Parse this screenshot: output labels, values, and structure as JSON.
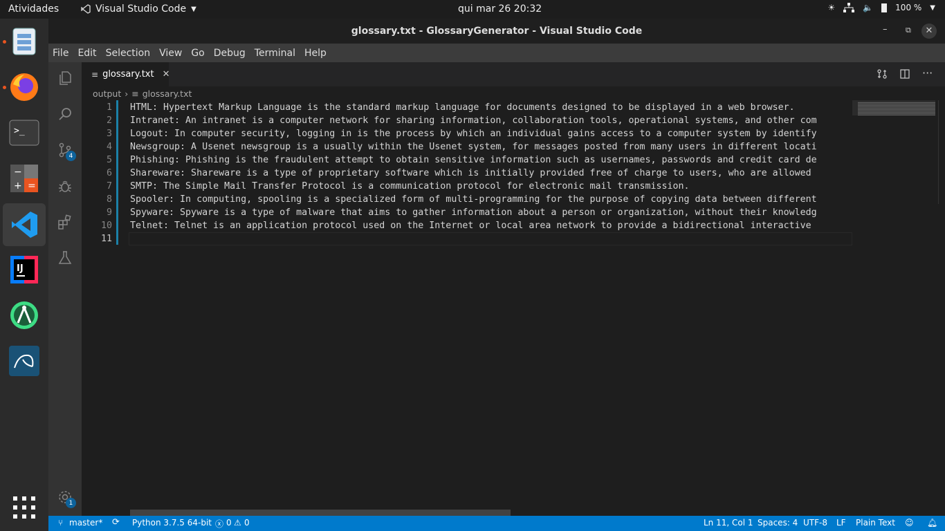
{
  "system": {
    "activities": "Atividades",
    "app_name": "Visual Studio Code",
    "clock": "qui mar 26  20:32",
    "battery": "100 %"
  },
  "window": {
    "title": "glossary.txt - GlossaryGenerator - Visual Studio Code"
  },
  "menu": [
    "File",
    "Edit",
    "Selection",
    "View",
    "Go",
    "Debug",
    "Terminal",
    "Help"
  ],
  "activity_bar": {
    "scm_badge": "4",
    "settings_badge": "1"
  },
  "tab": {
    "label": "glossary.txt"
  },
  "breadcrumb": {
    "folder": "output",
    "file": "glossary.txt"
  },
  "editor": {
    "lines": [
      "HTML: Hypertext Markup Language is the standard markup language for documents designed to be displayed in a web browser.",
      "Intranet: An intranet is a computer network for sharing information, collaboration tools, operational systems, and other com",
      "Logout: In computer security, logging in is the process by which an individual gains access to a computer system by identify",
      "Newsgroup: A Usenet newsgroup is a usually within the Usenet system, for messages posted from many users in different locati",
      "Phishing: Phishing is the fraudulent attempt to obtain sensitive information such as usernames, passwords and credit card de",
      "Shareware: Shareware is a type of proprietary software which is initially provided free of charge to users, who are allowed",
      "SMTP: The Simple Mail Transfer Protocol is a communication protocol for electronic mail transmission.",
      "Spooler: In computing, spooling is a specialized form of multi-programming for the purpose of copying data between different",
      "Spyware: Spyware is a type of malware that aims to gather information about a person or organization, without their knowledg",
      "Telnet: Telnet is an application protocol used on the Internet or local area network to provide a bidirectional interactive",
      ""
    ]
  },
  "status": {
    "branch": "master*",
    "python": "Python 3.7.5 64-bit",
    "errors": "0",
    "warnings": "0",
    "position": "Ln 11, Col 1",
    "spaces": "Spaces: 4",
    "encoding": "UTF-8",
    "eol": "LF",
    "language": "Plain Text"
  },
  "colors": {
    "accent": "#007acc",
    "editor_bg": "#1e1e1e",
    "ubuntu_orange": "#e95420"
  }
}
